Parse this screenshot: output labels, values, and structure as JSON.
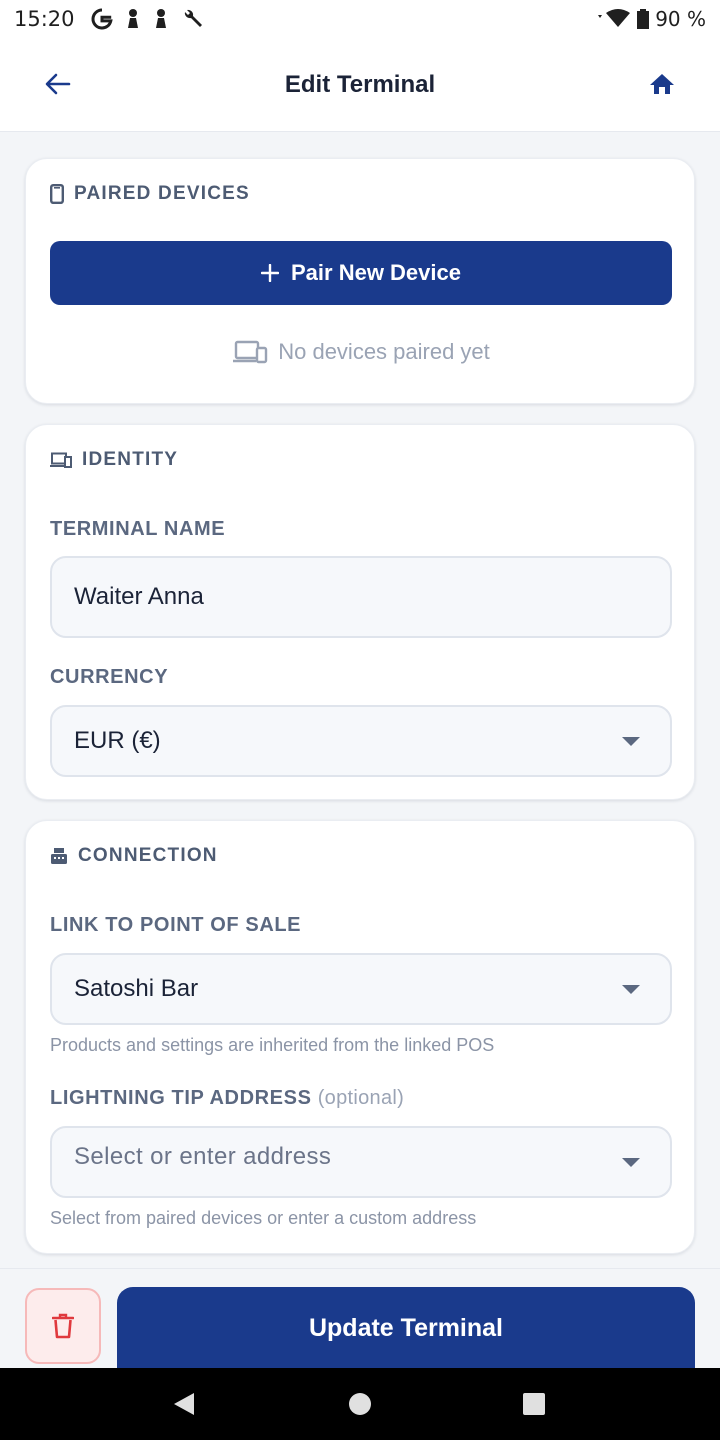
{
  "status_bar": {
    "time": "15:20",
    "battery": "90 %",
    "icons": [
      "google-icon",
      "notification-icon",
      "notification-icon",
      "wrench-icon",
      "wifi-icon",
      "battery-icon"
    ]
  },
  "header": {
    "title": "Edit Terminal",
    "back_icon": "arrow-left-icon",
    "home_icon": "home-icon"
  },
  "paired_devices": {
    "heading": "PAIRED DEVICES",
    "pair_button": "Pair New Device",
    "empty_text": "No devices paired yet"
  },
  "identity": {
    "heading": "IDENTITY",
    "terminal_name_label": "TERMINAL NAME",
    "terminal_name_value": "Waiter Anna",
    "currency_label": "CURRENCY",
    "currency_value": "EUR (€)"
  },
  "connection": {
    "heading": "CONNECTION",
    "pos_label": "LINK TO POINT OF SALE",
    "pos_value": "Satoshi Bar",
    "pos_helper": "Products and settings are inherited from the linked POS",
    "tip_label": "LIGHTNING TIP ADDRESS",
    "tip_label_optional": "(optional)",
    "tip_placeholder": "Select or enter address",
    "tip_helper": "Select from paired devices or enter a custom address"
  },
  "actions": {
    "update_button": "Update Terminal",
    "delete_icon": "trash-icon"
  },
  "colors": {
    "primary": "#1a3a8c",
    "danger": "#e0393e",
    "danger_bg": "#fdecec",
    "muted_text": "#9aa3b4",
    "label_text": "#5b6880"
  }
}
